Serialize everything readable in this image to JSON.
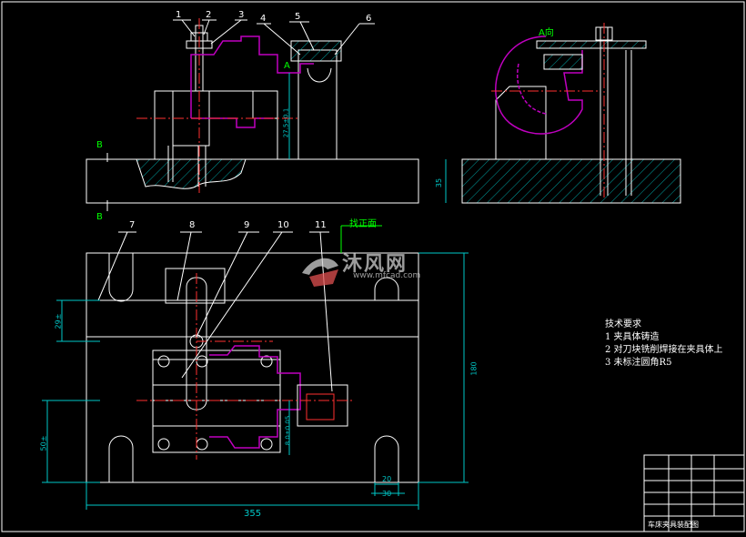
{
  "drawing": {
    "part_numbers": [
      "1",
      "2",
      "3",
      "4",
      "5",
      "6",
      "7",
      "8",
      "9",
      "10",
      "11"
    ],
    "section_labels": {
      "b_top": "B",
      "b_bottom": "B",
      "view_a": "A向",
      "view_a_arrow": "A"
    },
    "datum_note": "找正面",
    "dimensions": {
      "overall_width": "355",
      "slot_width": "20",
      "slot_outer": "30",
      "height_right": "180",
      "left_upper": "29±",
      "left_lower": "50±",
      "side_base": "35",
      "vertical_small": "27.5±0.1",
      "center_small": "8.0±0.05"
    },
    "tech_requirements": {
      "title": "技术要求",
      "items": [
        "1  夹具体铸造",
        "2  对刀块铣削焊接在夹具体上",
        "3  未标注圆角R5"
      ]
    },
    "title_block": {
      "name": "车床夹具装配图"
    },
    "watermark": {
      "brand": "沐风网",
      "url": "www.mfcad.com"
    },
    "colors": {
      "outline": "#ffffff",
      "part": "#c000c0",
      "centerline": "#ff3030",
      "dimension": "#00c8c8",
      "hatch": "#00a0a0",
      "leader": "#ffffff",
      "datum": "#00ff00",
      "notes_text": "#ffffff",
      "frame": "#ffffff"
    }
  }
}
